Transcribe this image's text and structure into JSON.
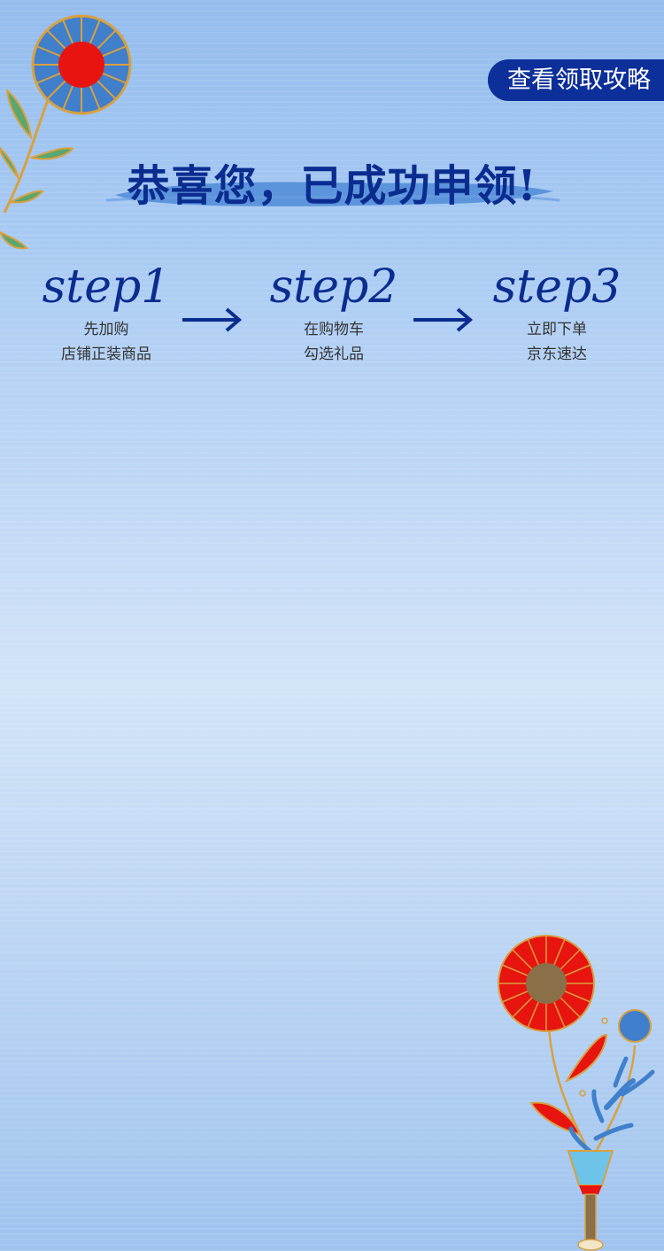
{
  "header": {
    "strategy_button_label": "查看领取攻略"
  },
  "banner": {
    "headline": "恭喜您，已成功申领!"
  },
  "steps": [
    {
      "title": "step1",
      "line1": "先加购",
      "line2": "店铺正装商品"
    },
    {
      "title": "step2",
      "line1": "在购物车",
      "line2": "勾选礼品"
    },
    {
      "title": "step3",
      "line1": "立即下单",
      "line2": "京东速达"
    }
  ],
  "colors": {
    "accent": "#0d2f9a",
    "text_dark": "#333333",
    "flower_red": "#e8140f",
    "flower_blue": "#3f7fcb",
    "leaf_green": "#5aa66f",
    "stem_gold": "#d9a040"
  },
  "icons": [
    "arrow-right-icon",
    "flower-top-left-icon",
    "flower-vase-bottom-right-icon"
  ]
}
